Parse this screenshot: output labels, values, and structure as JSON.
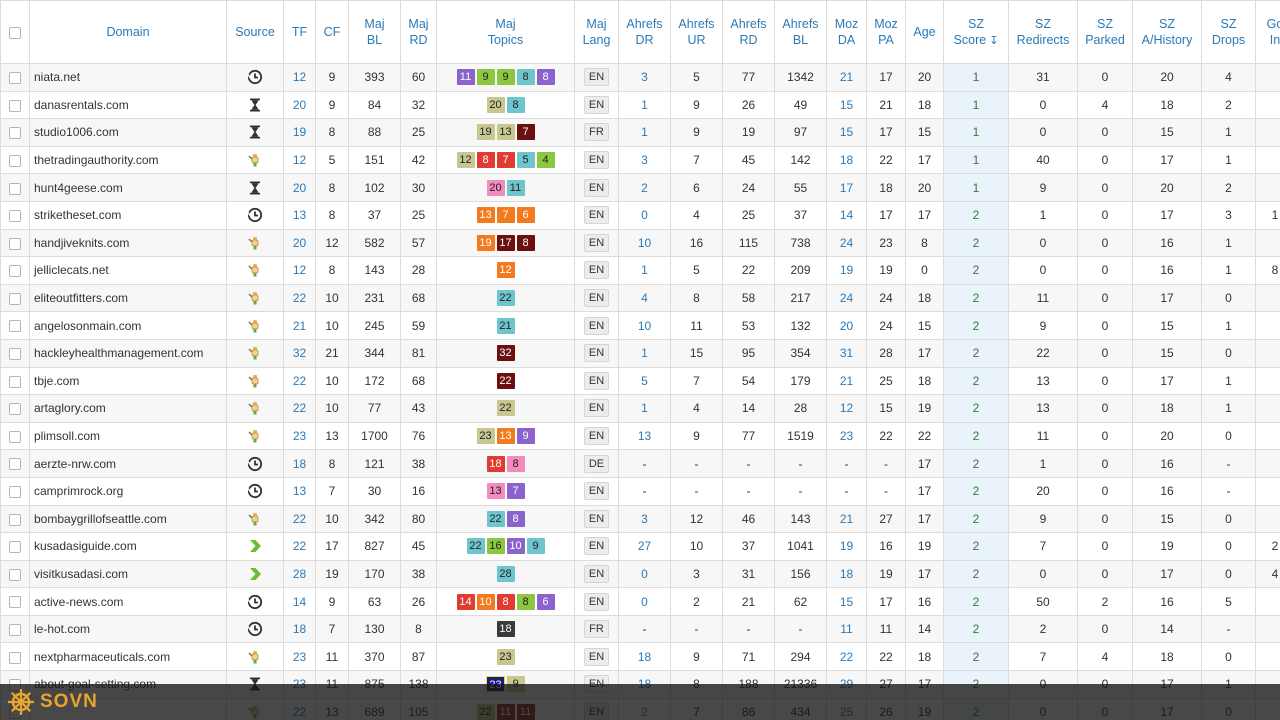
{
  "columns": [
    {
      "key": "cb",
      "label": ""
    },
    {
      "key": "domain",
      "label": "Domain"
    },
    {
      "key": "source",
      "label": "Source"
    },
    {
      "key": "tf",
      "label": "TF"
    },
    {
      "key": "cf",
      "label": "CF"
    },
    {
      "key": "majbl",
      "label": "Maj\nBL"
    },
    {
      "key": "majrd",
      "label": "Maj\nRD"
    },
    {
      "key": "topics",
      "label": "Maj\nTopics"
    },
    {
      "key": "lang",
      "label": "Maj\nLang"
    },
    {
      "key": "dr",
      "label": "Ahrefs\nDR"
    },
    {
      "key": "ur",
      "label": "Ahrefs\nUR"
    },
    {
      "key": "ard",
      "label": "Ahrefs\nRD"
    },
    {
      "key": "abl",
      "label": "Ahrefs\nBL"
    },
    {
      "key": "da",
      "label": "Moz\nDA"
    },
    {
      "key": "pa",
      "label": "Moz\nPA"
    },
    {
      "key": "age",
      "label": "Age"
    },
    {
      "key": "score",
      "label": "SZ\nScore"
    },
    {
      "key": "redir",
      "label": "SZ\nRedirects"
    },
    {
      "key": "parked",
      "label": "SZ\nParked"
    },
    {
      "key": "hist",
      "label": "SZ\nA/History"
    },
    {
      "key": "drops",
      "label": "SZ\nDrops"
    },
    {
      "key": "goi",
      "label": "Go\nIn"
    }
  ],
  "icons": {
    "clock": "clock-icon",
    "hourglass": "hourglass-icon",
    "hand": "hand-auction-icon",
    "arrow": "green-arrow-icon",
    "sort": "sort-icon"
  },
  "topic_colors": {
    "purple": "#8a63cf",
    "green": "#8dc63f",
    "khaki": "#c8c78f",
    "teal": "#6ec6cc",
    "maroon": "#6b0f10",
    "red": "#e03c31",
    "orange": "#f47a20",
    "pink": "#f28bbf",
    "navy": "#1a1a8c",
    "dark": "#3a3a3a",
    "darkred": "#9c2a1f"
  },
  "rows": [
    {
      "domain": "niata.net",
      "source": "clock",
      "tf": "12",
      "cf": "9",
      "majbl": "393",
      "majrd": "60",
      "topics": [
        [
          "11",
          "purple"
        ],
        [
          "9",
          "green"
        ],
        [
          "9",
          "green"
        ],
        [
          "8",
          "teal"
        ],
        [
          "8",
          "purple"
        ]
      ],
      "lang": "EN",
      "dr": "3",
      "ur": "5",
      "ard": "77",
      "abl": "1342",
      "da": "21",
      "pa": "17",
      "age": "20",
      "score": "1",
      "redir": "31",
      "parked": "0",
      "hist": "20",
      "drops": "4",
      "goi": ""
    },
    {
      "domain": "danasrentals.com",
      "source": "hourglass",
      "tf": "20",
      "cf": "9",
      "majbl": "84",
      "majrd": "32",
      "topics": [
        [
          "20",
          "khaki"
        ],
        [
          "8",
          "teal"
        ]
      ],
      "lang": "EN",
      "dr": "1",
      "ur": "9",
      "ard": "26",
      "abl": "49",
      "da": "15",
      "pa": "21",
      "age": "18",
      "score": "1",
      "redir": "0",
      "parked": "4",
      "hist": "18",
      "drops": "2",
      "goi": ""
    },
    {
      "domain": "studio1006.com",
      "source": "hourglass",
      "tf": "19",
      "cf": "8",
      "majbl": "88",
      "majrd": "25",
      "topics": [
        [
          "19",
          "khaki"
        ],
        [
          "13",
          "khaki"
        ],
        [
          "7",
          "maroon"
        ]
      ],
      "lang": "FR",
      "dr": "1",
      "ur": "9",
      "ard": "19",
      "abl": "97",
      "da": "15",
      "pa": "17",
      "age": "15",
      "score": "1",
      "redir": "0",
      "parked": "0",
      "hist": "15",
      "drops": "1",
      "goi": ""
    },
    {
      "domain": "thetradingauthority.com",
      "source": "hand",
      "tf": "12",
      "cf": "5",
      "majbl": "151",
      "majrd": "42",
      "topics": [
        [
          "12",
          "khaki"
        ],
        [
          "8",
          "red"
        ],
        [
          "7",
          "red"
        ],
        [
          "5",
          "teal"
        ],
        [
          "4",
          "green"
        ]
      ],
      "lang": "EN",
      "dr": "3",
      "ur": "7",
      "ard": "45",
      "abl": "142",
      "da": "18",
      "pa": "22",
      "age": "17",
      "score": "1",
      "redir": "40",
      "parked": "0",
      "hist": "17",
      "drops": "1",
      "goi": ""
    },
    {
      "domain": "hunt4geese.com",
      "source": "hourglass",
      "tf": "20",
      "cf": "8",
      "majbl": "102",
      "majrd": "30",
      "topics": [
        [
          "20",
          "pink"
        ],
        [
          "11",
          "teal"
        ]
      ],
      "lang": "EN",
      "dr": "2",
      "ur": "6",
      "ard": "24",
      "abl": "55",
      "da": "17",
      "pa": "18",
      "age": "20",
      "score": "1",
      "redir": "9",
      "parked": "0",
      "hist": "20",
      "drops": "2",
      "goi": ""
    },
    {
      "domain": "striketheset.com",
      "source": "clock",
      "tf": "13",
      "cf": "8",
      "majbl": "37",
      "majrd": "25",
      "topics": [
        [
          "13",
          "orange"
        ],
        [
          "7",
          "orange"
        ],
        [
          "6",
          "orange"
        ]
      ],
      "lang": "EN",
      "dr": "0",
      "ur": "4",
      "ard": "25",
      "abl": "37",
      "da": "14",
      "pa": "17",
      "age": "17",
      "score": "2",
      "redir": "1",
      "parked": "0",
      "hist": "17",
      "drops": "3",
      "goi": "1"
    },
    {
      "domain": "handjiveknits.com",
      "source": "hand",
      "tf": "20",
      "cf": "12",
      "majbl": "582",
      "majrd": "57",
      "topics": [
        [
          "19",
          "orange"
        ],
        [
          "17",
          "maroon"
        ],
        [
          "8",
          "maroon"
        ]
      ],
      "lang": "EN",
      "dr": "10",
      "ur": "16",
      "ard": "115",
      "abl": "738",
      "da": "24",
      "pa": "23",
      "age": "8",
      "score": "2",
      "redir": "0",
      "parked": "0",
      "hist": "16",
      "drops": "1",
      "goi": ""
    },
    {
      "domain": "jelliclecats.net",
      "source": "hand",
      "tf": "12",
      "cf": "8",
      "majbl": "143",
      "majrd": "28",
      "topics": [
        [
          "12",
          "orange"
        ]
      ],
      "lang": "EN",
      "dr": "1",
      "ur": "5",
      "ard": "22",
      "abl": "209",
      "da": "19",
      "pa": "19",
      "age": "0",
      "score": "2",
      "redir": "0",
      "parked": "0",
      "hist": "16",
      "drops": "1",
      "goi": "8"
    },
    {
      "domain": "eliteoutfitters.com",
      "source": "hand",
      "tf": "22",
      "cf": "10",
      "majbl": "231",
      "majrd": "68",
      "topics": [
        [
          "22",
          "teal"
        ]
      ],
      "lang": "EN",
      "dr": "4",
      "ur": "8",
      "ard": "58",
      "abl": "217",
      "da": "24",
      "pa": "24",
      "age": "18",
      "score": "2",
      "redir": "11",
      "parked": "0",
      "hist": "17",
      "drops": "0",
      "goi": ""
    },
    {
      "domain": "angelosonmain.com",
      "source": "hand",
      "tf": "21",
      "cf": "10",
      "majbl": "245",
      "majrd": "59",
      "topics": [
        [
          "21",
          "teal"
        ]
      ],
      "lang": "EN",
      "dr": "10",
      "ur": "11",
      "ard": "53",
      "abl": "132",
      "da": "20",
      "pa": "24",
      "age": "15",
      "score": "2",
      "redir": "9",
      "parked": "0",
      "hist": "15",
      "drops": "1",
      "goi": ""
    },
    {
      "domain": "hackleyhealthmanagement.com",
      "source": "hand",
      "tf": "32",
      "cf": "21",
      "majbl": "344",
      "majrd": "81",
      "topics": [
        [
          "32",
          "maroon"
        ]
      ],
      "lang": "EN",
      "dr": "1",
      "ur": "15",
      "ard": "95",
      "abl": "354",
      "da": "31",
      "pa": "28",
      "age": "17",
      "score": "2",
      "redir": "22",
      "parked": "0",
      "hist": "15",
      "drops": "0",
      "goi": ""
    },
    {
      "domain": "tbje.com",
      "source": "hand",
      "tf": "22",
      "cf": "10",
      "majbl": "172",
      "majrd": "68",
      "topics": [
        [
          "22",
          "maroon"
        ]
      ],
      "lang": "EN",
      "dr": "5",
      "ur": "7",
      "ard": "54",
      "abl": "179",
      "da": "21",
      "pa": "25",
      "age": "18",
      "score": "2",
      "redir": "13",
      "parked": "0",
      "hist": "17",
      "drops": "1",
      "goi": ""
    },
    {
      "domain": "artaglory.com",
      "source": "hand",
      "tf": "22",
      "cf": "10",
      "majbl": "77",
      "majrd": "43",
      "topics": [
        [
          "22",
          "khaki"
        ]
      ],
      "lang": "EN",
      "dr": "1",
      "ur": "4",
      "ard": "14",
      "abl": "28",
      "da": "12",
      "pa": "15",
      "age": "19",
      "score": "2",
      "redir": "13",
      "parked": "0",
      "hist": "18",
      "drops": "1",
      "goi": ""
    },
    {
      "domain": "plimsoll.com",
      "source": "hand",
      "tf": "23",
      "cf": "13",
      "majbl": "1700",
      "majrd": "76",
      "topics": [
        [
          "23",
          "khaki"
        ],
        [
          "13",
          "orange"
        ],
        [
          "9",
          "purple"
        ]
      ],
      "lang": "EN",
      "dr": "13",
      "ur": "9",
      "ard": "77",
      "abl": "1519",
      "da": "23",
      "pa": "22",
      "age": "22",
      "score": "2",
      "redir": "11",
      "parked": "0",
      "hist": "20",
      "drops": "0",
      "goi": ""
    },
    {
      "domain": "aerzte-nrw.com",
      "source": "clock",
      "tf": "18",
      "cf": "8",
      "majbl": "121",
      "majrd": "38",
      "topics": [
        [
          "18",
          "red"
        ],
        [
          "8",
          "pink"
        ]
      ],
      "lang": "DE",
      "dr": "-",
      "ur": "-",
      "ard": "-",
      "abl": "-",
      "da": "-",
      "pa": "-",
      "age": "17",
      "score": "2",
      "redir": "1",
      "parked": "0",
      "hist": "16",
      "drops": "-",
      "goi": ""
    },
    {
      "domain": "camprimrock.org",
      "source": "clock",
      "tf": "13",
      "cf": "7",
      "majbl": "30",
      "majrd": "16",
      "topics": [
        [
          "13",
          "pink"
        ],
        [
          "7",
          "purple"
        ]
      ],
      "lang": "EN",
      "dr": "-",
      "ur": "-",
      "ard": "-",
      "abl": "-",
      "da": "-",
      "pa": "-",
      "age": "17",
      "score": "2",
      "redir": "20",
      "parked": "0",
      "hist": "16",
      "drops": "-",
      "goi": ""
    },
    {
      "domain": "bombaygrillofseattle.com",
      "source": "hand",
      "tf": "22",
      "cf": "10",
      "majbl": "342",
      "majrd": "80",
      "topics": [
        [
          "22",
          "teal"
        ],
        [
          "8",
          "purple"
        ]
      ],
      "lang": "EN",
      "dr": "3",
      "ur": "12",
      "ard": "46",
      "abl": "143",
      "da": "21",
      "pa": "27",
      "age": "17",
      "score": "2",
      "redir": "9",
      "parked": "0",
      "hist": "15",
      "drops": "0",
      "goi": ""
    },
    {
      "domain": "kusadasiguide.com",
      "source": "arrow",
      "tf": "22",
      "cf": "17",
      "majbl": "827",
      "majrd": "45",
      "topics": [
        [
          "22",
          "teal"
        ],
        [
          "16",
          "green"
        ],
        [
          "10",
          "purple"
        ],
        [
          "9",
          "teal"
        ]
      ],
      "lang": "EN",
      "dr": "27",
      "ur": "10",
      "ard": "37",
      "abl": "1041",
      "da": "19",
      "pa": "16",
      "age": "19",
      "score": "2",
      "redir": "7",
      "parked": "0",
      "hist": "19",
      "drops": "0",
      "goi": "2"
    },
    {
      "domain": "visitkusadasi.com",
      "source": "arrow",
      "tf": "28",
      "cf": "19",
      "majbl": "170",
      "majrd": "38",
      "topics": [
        [
          "28",
          "teal"
        ]
      ],
      "lang": "EN",
      "dr": "0",
      "ur": "3",
      "ard": "31",
      "abl": "156",
      "da": "18",
      "pa": "19",
      "age": "17",
      "score": "2",
      "redir": "0",
      "parked": "0",
      "hist": "17",
      "drops": "0",
      "goi": "4"
    },
    {
      "domain": "active-news.com",
      "source": "clock",
      "tf": "14",
      "cf": "9",
      "majbl": "63",
      "majrd": "26",
      "topics": [
        [
          "14",
          "red"
        ],
        [
          "10",
          "orange"
        ],
        [
          "8",
          "red"
        ],
        [
          "8",
          "green"
        ],
        [
          "6",
          "purple"
        ]
      ],
      "lang": "EN",
      "dr": "0",
      "ur": "2",
      "ard": "21",
      "abl": "62",
      "da": "15",
      "pa": "17",
      "age": "16",
      "score": "2",
      "redir": "50",
      "parked": "2",
      "hist": "16",
      "drops": "5",
      "goi": ""
    },
    {
      "domain": "le-hot.com",
      "source": "clock",
      "tf": "18",
      "cf": "7",
      "majbl": "130",
      "majrd": "8",
      "topics": [
        [
          "18",
          "dark"
        ]
      ],
      "lang": "FR",
      "dr": "-",
      "ur": "-",
      "ard": "-",
      "abl": "-",
      "da": "11",
      "pa": "11",
      "age": "14",
      "score": "2",
      "redir": "2",
      "parked": "0",
      "hist": "14",
      "drops": "-",
      "goi": ""
    },
    {
      "domain": "nextpharmaceuticals.com",
      "source": "hand",
      "tf": "23",
      "cf": "11",
      "majbl": "370",
      "majrd": "87",
      "topics": [
        [
          "23",
          "khaki"
        ]
      ],
      "lang": "EN",
      "dr": "18",
      "ur": "9",
      "ard": "71",
      "abl": "294",
      "da": "22",
      "pa": "22",
      "age": "18",
      "score": "2",
      "redir": "7",
      "parked": "4",
      "hist": "18",
      "drops": "0",
      "goi": ""
    },
    {
      "domain": "about-goal-setting.com",
      "source": "hourglass",
      "tf": "23",
      "cf": "11",
      "majbl": "875",
      "majrd": "138",
      "topics": [
        [
          "23",
          "navy"
        ],
        [
          "9",
          "khaki"
        ]
      ],
      "lang": "EN",
      "dr": "18",
      "ur": "8",
      "ard": "188",
      "abl": "21336",
      "da": "29",
      "pa": "27",
      "age": "17",
      "score": "2",
      "redir": "0",
      "parked": "0",
      "hist": "17",
      "drops": "1",
      "goi": ""
    },
    {
      "domain": "",
      "source": "hand",
      "tf": "22",
      "cf": "13",
      "majbl": "689",
      "majrd": "105",
      "topics": [
        [
          "22",
          "khaki"
        ],
        [
          "11",
          "darkred"
        ],
        [
          "11",
          "darkred"
        ]
      ],
      "lang": "EN",
      "dr": "2",
      "ur": "7",
      "ard": "86",
      "abl": "434",
      "da": "25",
      "pa": "26",
      "age": "19",
      "score": "2",
      "redir": "0",
      "parked": "0",
      "hist": "17",
      "drops": "0",
      "goi": ""
    }
  ],
  "footer": {
    "logo_text": "SOVN",
    "logo_icon": "ship-wheel-icon",
    "logo_color": "#e8a42c"
  }
}
